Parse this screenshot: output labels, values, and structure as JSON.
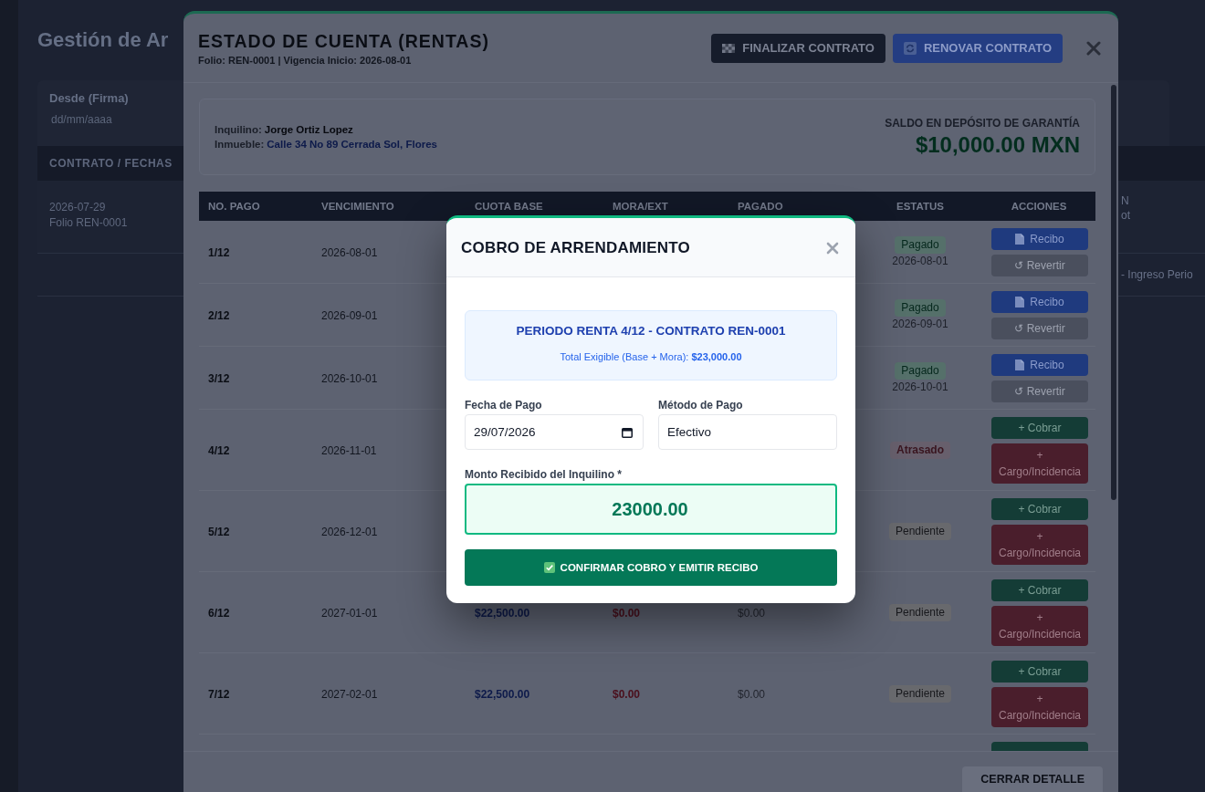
{
  "background_page": {
    "title": "Gestión de Ar",
    "filter": {
      "label": "Desde (Firma)",
      "placeholder": "dd/mm/aaaa"
    },
    "table": {
      "columns": [
        "CONTRATO / FECHAS"
      ],
      "rows": [
        {
          "column_1": [
            "2026-07-29",
            "Folio REN-0001"
          ],
          "column_2": [
            "N",
            "ot"
          ]
        },
        {
          "column_2": [
            "- Ingreso Perio"
          ]
        }
      ]
    }
  },
  "account_statement": {
    "title": "ESTADO DE CUENTA (RENTAS)",
    "subtitle": "Folio: REN-0001 | Vigencia Inicio: 2026-08-01",
    "actions": [
      {
        "kind": "finalize",
        "label": "FINALIZAR CONTRATO"
      },
      {
        "kind": "renew",
        "label": "RENOVAR CONTRATO"
      }
    ],
    "tenant": {
      "label": "Inquilino:",
      "value": "Jorge Ortiz Lopez"
    },
    "property": {
      "label": "Inmueble:",
      "value": "Calle 34 No 89 Cerrada Sol, Flores"
    },
    "deposit": {
      "label": "SALDO EN DEPÓSITO DE GARANTÍA",
      "amount": "$10,000.00 MXN"
    },
    "table": {
      "columns": [
        "NO. PAGO",
        "VENCIMIENTO",
        "CUOTA BASE",
        "MORA/EXT",
        "PAGADO",
        "ESTATUS",
        "ACCIONES"
      ],
      "rows": [
        {
          "number": "1/12",
          "due": "2026-08-01",
          "status": {
            "kind": "paid",
            "label": "Pagado",
            "date": "2026-08-01"
          },
          "actions": [
            {
              "kind": "receipt",
              "label": "Recibo"
            },
            {
              "kind": "revert",
              "label": "↺ Revertir"
            }
          ]
        },
        {
          "number": "2/12",
          "due": "2026-09-01",
          "status": {
            "kind": "paid",
            "label": "Pagado",
            "date": "2026-09-01"
          },
          "actions": [
            {
              "kind": "receipt",
              "label": "Recibo"
            },
            {
              "kind": "revert",
              "label": "↺ Revertir"
            }
          ]
        },
        {
          "number": "3/12",
          "due": "2026-10-01",
          "status": {
            "kind": "paid",
            "label": "Pagado",
            "date": "2026-10-01"
          },
          "actions": [
            {
              "kind": "receipt",
              "label": "Recibo"
            },
            {
              "kind": "revert",
              "label": "↺ Revertir"
            }
          ]
        },
        {
          "number": "4/12",
          "due": "2026-11-01",
          "status": {
            "kind": "overdue",
            "label": "Atrasado"
          },
          "actions": [
            {
              "kind": "collect",
              "label": "+ Cobrar"
            },
            {
              "kind": "incident",
              "label": "+ Cargo/Incidencia"
            }
          ]
        },
        {
          "number": "5/12",
          "due": "2026-12-01",
          "status": {
            "kind": "pending",
            "label": "Pendiente"
          },
          "actions": [
            {
              "kind": "collect",
              "label": "+ Cobrar"
            },
            {
              "kind": "incident",
              "label": "+ Cargo/Incidencia"
            }
          ]
        },
        {
          "number": "6/12",
          "due": "2027-01-01",
          "base": "$22,500.00",
          "late": "$0.00",
          "paid": "$0.00",
          "status": {
            "kind": "pending",
            "label": "Pendiente"
          },
          "actions": [
            {
              "kind": "collect",
              "label": "+ Cobrar"
            },
            {
              "kind": "incident",
              "label": "+ Cargo/Incidencia"
            }
          ]
        },
        {
          "number": "7/12",
          "due": "2027-02-01",
          "base": "$22,500.00",
          "late": "$0.00",
          "paid": "$0.00",
          "status": {
            "kind": "pending",
            "label": "Pendiente"
          },
          "actions": [
            {
              "kind": "collect",
              "label": "+ Cobrar"
            },
            {
              "kind": "incident",
              "label": "+ Cargo/Incidencia"
            }
          ]
        },
        {
          "actions": [
            {
              "kind": "collect"
            }
          ]
        }
      ]
    },
    "footer_button": "CERRAR DETALLE"
  },
  "payment_dialog": {
    "title": "COBRO DE ARRENDAMIENTO",
    "summary": {
      "heading": "PERIODO RENTA 4/12 - CONTRATO REN-0001",
      "total": "Total Exigible (Base + Mora): **$23,000.00**"
    },
    "fields": [
      {
        "kind": "date",
        "label": "Fecha de Pago",
        "value": "29/07/2026"
      },
      {
        "kind": "text",
        "label": "Método de Pago",
        "value": "Efectivo"
      },
      {
        "kind": "amount",
        "label": "Monto Recibido del Inquilino *",
        "value": "23000.00"
      }
    ],
    "confirm_button": "CONFIRMAR COBRO Y EMITIR RECIBO"
  }
}
